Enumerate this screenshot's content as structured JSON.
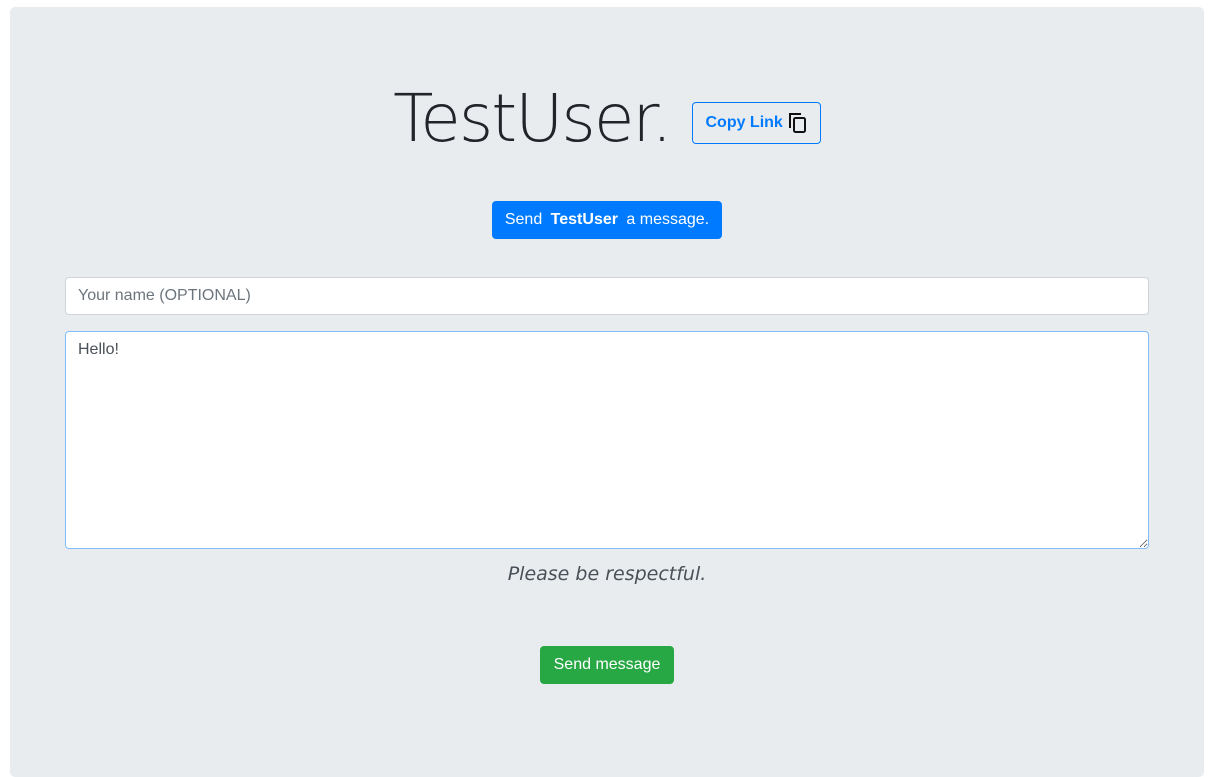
{
  "header": {
    "title": "TestUser.",
    "copy_link_label": "Copy Link",
    "copy_icon": "copy-icon"
  },
  "banner": {
    "prefix": "Send ",
    "username": "TestUser",
    "suffix": " a message."
  },
  "form": {
    "name_placeholder": "Your name (OPTIONAL)",
    "name_value": "",
    "message_value": "Hello!",
    "hint": "Please be respectful.",
    "submit_label": "Send message"
  },
  "colors": {
    "primary": "#007bff",
    "success": "#28a745",
    "background": "#e9ecef"
  }
}
